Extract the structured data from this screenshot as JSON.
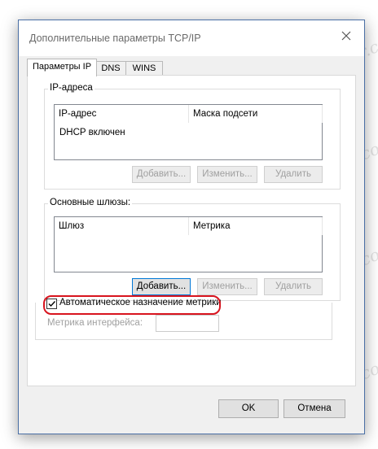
{
  "window": {
    "title": "Дополнительные параметры TCP/IP"
  },
  "tabs": [
    {
      "label": "Параметры IP",
      "active": true
    },
    {
      "label": "DNS"
    },
    {
      "label": "WINS"
    }
  ],
  "ip_group": {
    "legend": "IP-адреса",
    "columns": [
      "IP-адрес",
      "Маска подсети"
    ],
    "rows": [
      "DHCP включен"
    ],
    "buttons": {
      "add": "Добавить...",
      "edit": "Изменить...",
      "remove": "Удалить"
    }
  },
  "gateway_group": {
    "legend": "Основные шлюзы:",
    "columns": [
      "Шлюз",
      "Метрика"
    ],
    "buttons": {
      "add": "Добавить...",
      "edit": "Изменить...",
      "remove": "Удалить"
    }
  },
  "auto_metric": {
    "label": "Автоматическое назначение метрики",
    "checked": true
  },
  "interface_metric": {
    "label": "Метрика интерфейса:",
    "value": ""
  },
  "footer": {
    "ok": "OK",
    "cancel": "Отмена"
  },
  "watermark": "Soringpcrepair.com",
  "colors": {
    "highlight": "#d8141e",
    "focus": "#0078d7",
    "border": "#4a6fa5"
  }
}
